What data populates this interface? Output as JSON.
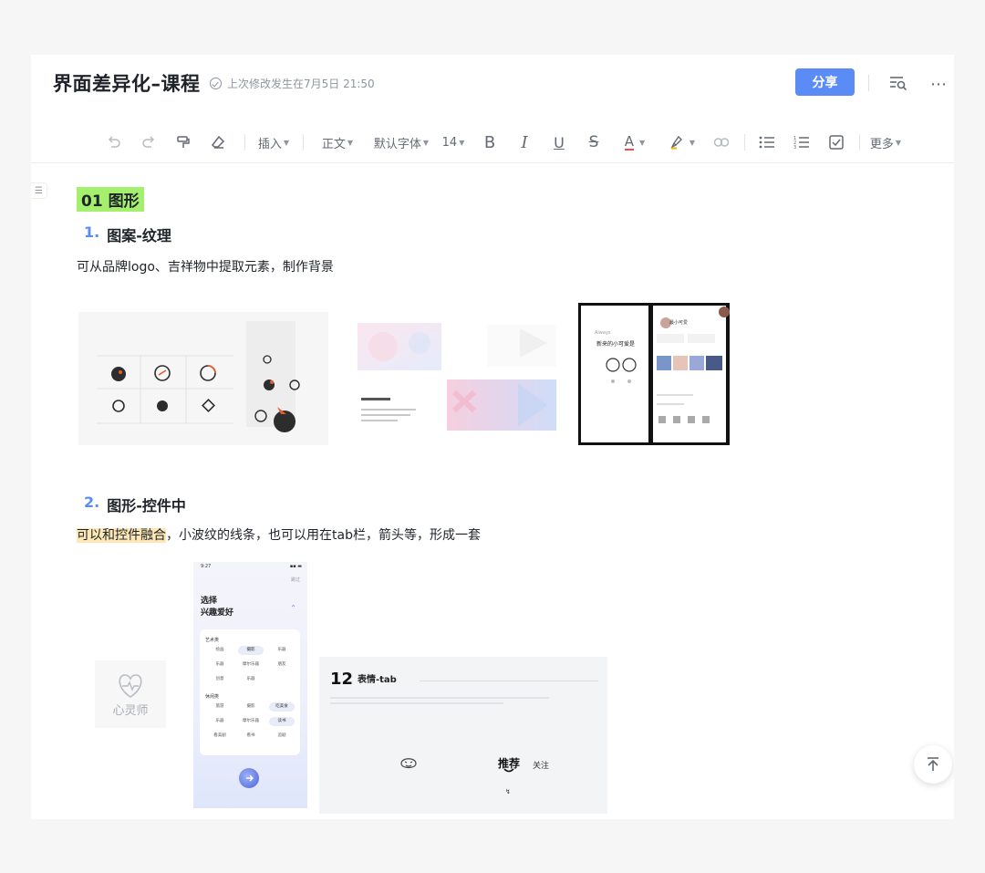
{
  "header": {
    "title": "界面差异化–课程",
    "saved_text": "上次修改发生在7月5日 21:50",
    "share_label": "分享"
  },
  "toolbar": {
    "insert": "插入",
    "style": "正文",
    "font": "默认字体",
    "size": "14",
    "more": "更多"
  },
  "content": {
    "h1": "01 图形",
    "sec1_num": "1.",
    "sec1_title": "图案-纹理",
    "sec1_text": "可从品牌logo、吉祥物中提取元素，制作背景",
    "sec2_num": "2.",
    "sec2_title": "图形-控件中",
    "sec2_hl": "可以和控件融合",
    "sec2_text": "，小波纹的线条，也可以用在tab栏，箭头等，形成一套"
  },
  "images": {
    "img3_tag": "Always",
    "img3_title": "新来的小可爱是",
    "img4_name": "最小可爱",
    "img5_time": "9:27",
    "img5_skip": "跳过",
    "img5_title1": "选择",
    "img5_title2": "兴趣爱好",
    "img5_group1": "艺术类",
    "img5_group2": "休闲类",
    "img5_tags": [
      "绘画",
      "摄影",
      "乐器",
      "乐器",
      "摩尔乐器",
      "朋友",
      "创意",
      "乐器",
      "旅游",
      "摄影",
      "吃美食",
      "乐器",
      "摩尔乐器",
      "读书",
      "看美剧",
      "看书",
      "追剧"
    ],
    "img6_label": "心灵师",
    "img7_num": "12",
    "img7_title": "表情-tab",
    "img7_tab1": "推荐",
    "img7_tab2": "关注"
  },
  "colors": {
    "accent": "#5b8cf6",
    "heading_highlight": "#a4f06e",
    "text_highlight": "#fde8b5"
  }
}
